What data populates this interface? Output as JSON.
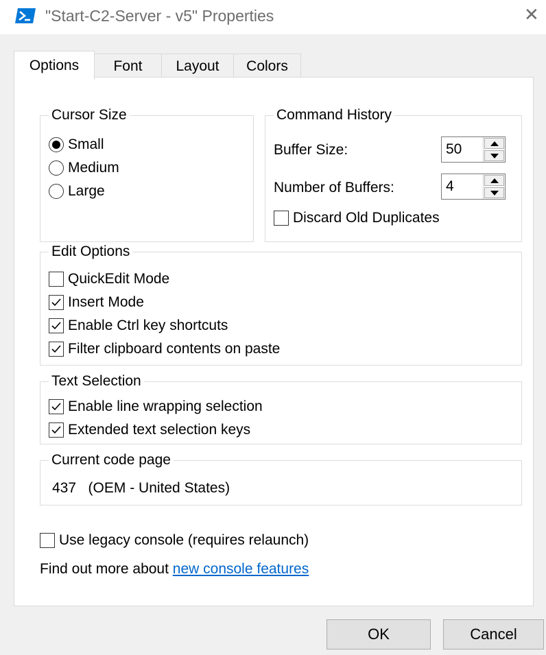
{
  "window": {
    "title": "\"Start-C2-Server - v5\" Properties",
    "close_glyph": "✕"
  },
  "tabs": [
    {
      "label": "Options",
      "active": true
    },
    {
      "label": "Font",
      "active": false
    },
    {
      "label": "Layout",
      "active": false
    },
    {
      "label": "Colors",
      "active": false
    }
  ],
  "cursor_size": {
    "title": "Cursor Size",
    "options": [
      {
        "label": "Small",
        "selected": true
      },
      {
        "label": "Medium",
        "selected": false
      },
      {
        "label": "Large",
        "selected": false
      }
    ]
  },
  "command_history": {
    "title": "Command History",
    "buffer_size": {
      "label": "Buffer Size:",
      "value": "50"
    },
    "number_of_buffers": {
      "label": "Number of Buffers:",
      "value": "4"
    },
    "discard_old_duplicates": {
      "label": "Discard Old Duplicates",
      "checked": false
    }
  },
  "edit_options": {
    "title": "Edit Options",
    "items": [
      {
        "label": "QuickEdit Mode",
        "checked": false
      },
      {
        "label": "Insert Mode",
        "checked": true
      },
      {
        "label": "Enable Ctrl key shortcuts",
        "checked": true
      },
      {
        "label": "Filter clipboard contents on paste",
        "checked": true
      }
    ]
  },
  "text_selection": {
    "title": "Text Selection",
    "items": [
      {
        "label": "Enable line wrapping selection",
        "checked": true
      },
      {
        "label": "Extended text selection keys",
        "checked": true
      }
    ]
  },
  "code_page": {
    "title": "Current code page",
    "value": "437   (OEM - United States)"
  },
  "legacy_console": {
    "label": "Use legacy console (requires relaunch)",
    "checked": false
  },
  "find_out_more": {
    "prefix": "Find out more about ",
    "link_text": "new console features"
  },
  "buttons": {
    "ok": "OK",
    "cancel": "Cancel"
  },
  "colors": {
    "highlight": "#ff0000",
    "link": "#0066cc",
    "accent": "#0078d7"
  },
  "icons": {
    "app": "powershell-icon",
    "close": "close-icon",
    "spin_up": "arrow-up-icon",
    "spin_down": "arrow-down-icon",
    "check": "checkmark-icon"
  }
}
